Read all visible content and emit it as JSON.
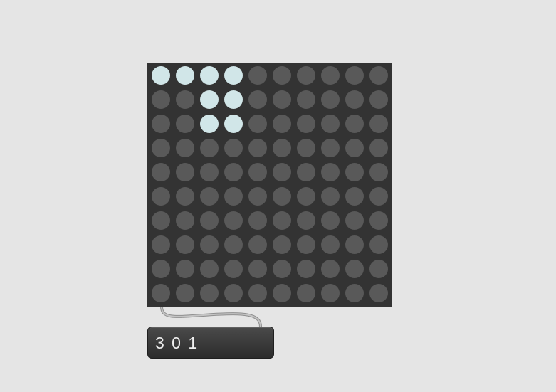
{
  "led_matrix": {
    "columns": 10,
    "rows": 10,
    "on_color": "#d1e6e8",
    "off_color": "#595959",
    "background_color": "#333333",
    "states": [
      [
        1,
        1,
        1,
        1,
        0,
        0,
        0,
        0,
        0,
        0
      ],
      [
        0,
        0,
        1,
        1,
        0,
        0,
        0,
        0,
        0,
        0
      ],
      [
        0,
        0,
        1,
        1,
        0,
        0,
        0,
        0,
        0,
        0
      ],
      [
        0,
        0,
        0,
        0,
        0,
        0,
        0,
        0,
        0,
        0
      ],
      [
        0,
        0,
        0,
        0,
        0,
        0,
        0,
        0,
        0,
        0
      ],
      [
        0,
        0,
        0,
        0,
        0,
        0,
        0,
        0,
        0,
        0
      ],
      [
        0,
        0,
        0,
        0,
        0,
        0,
        0,
        0,
        0,
        0
      ],
      [
        0,
        0,
        0,
        0,
        0,
        0,
        0,
        0,
        0,
        0
      ],
      [
        0,
        0,
        0,
        0,
        0,
        0,
        0,
        0,
        0,
        0
      ],
      [
        0,
        0,
        0,
        0,
        0,
        0,
        0,
        0,
        0,
        0
      ]
    ]
  },
  "message_box": {
    "text": "3 0 1"
  },
  "patch_cord": {
    "color": "#9a9a9a"
  }
}
